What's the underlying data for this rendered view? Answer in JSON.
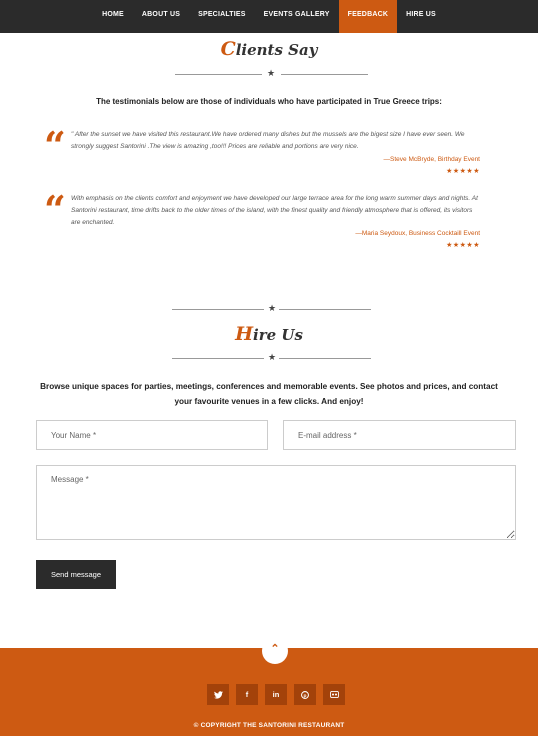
{
  "nav": {
    "items": [
      "HOME",
      "ABOUT US",
      "SPECIALTIES",
      "EVENTS GALLERY",
      "FEEDBACK",
      "HIRE US"
    ],
    "active_index": 4,
    "active_color": "#cd5a12"
  },
  "clients": {
    "title_first": "C",
    "title_rest": "lients Say",
    "intro": "The testimonials below are those of individuals who have participated in True Greece trips:",
    "testimonials": [
      {
        "text": "\" After the sunset we have visited this restaurant.We have ordered many dishes but the mussels are the bigest size I have ever seen. We strongly suggest Santorini .The view is amazing ,too!!! Prices are reliable and portions are very nice.",
        "author": "—Steve McBryde, Birthday Event",
        "stars": "★★★★★",
        "rating": 5
      },
      {
        "text": "With emphasis on the clients comfort and enjoyment we have developed our large terrace area for the long warm summer days and nights. At Santorini restaurant, time drifts back to the older times of the island, with the finest quality and friendly atmosphere that is offered, its visitors are enchanted.",
        "author": "—Maria Seydoux, Business Cocktaill Event",
        "stars": "★★★★★",
        "rating": 5
      }
    ]
  },
  "hire": {
    "title_first": "H",
    "title_rest": "ire Us",
    "intro": "Browse unique spaces for parties, meetings, conferences and memorable events.  See photos and prices, and contact your favourite venues in a few clicks. And enjoy!",
    "name_placeholder": "Your Name *",
    "email_placeholder": "E-mail address *",
    "message_placeholder": "Message *",
    "send_label": "Send message"
  },
  "footer": {
    "up_icon": "⌃",
    "socials": [
      {
        "name": "twitter-icon",
        "glyph": "🐦"
      },
      {
        "name": "facebook-icon",
        "glyph": "f"
      },
      {
        "name": "linkedin-icon",
        "glyph": "in"
      },
      {
        "name": "pinterest-icon",
        "glyph": "p"
      },
      {
        "name": "flickr-icon",
        "glyph": "●●"
      }
    ],
    "copyright": "© COPYRIGHT THE SANTORINI RESTAURANT",
    "bg_color": "#cd5a12"
  }
}
